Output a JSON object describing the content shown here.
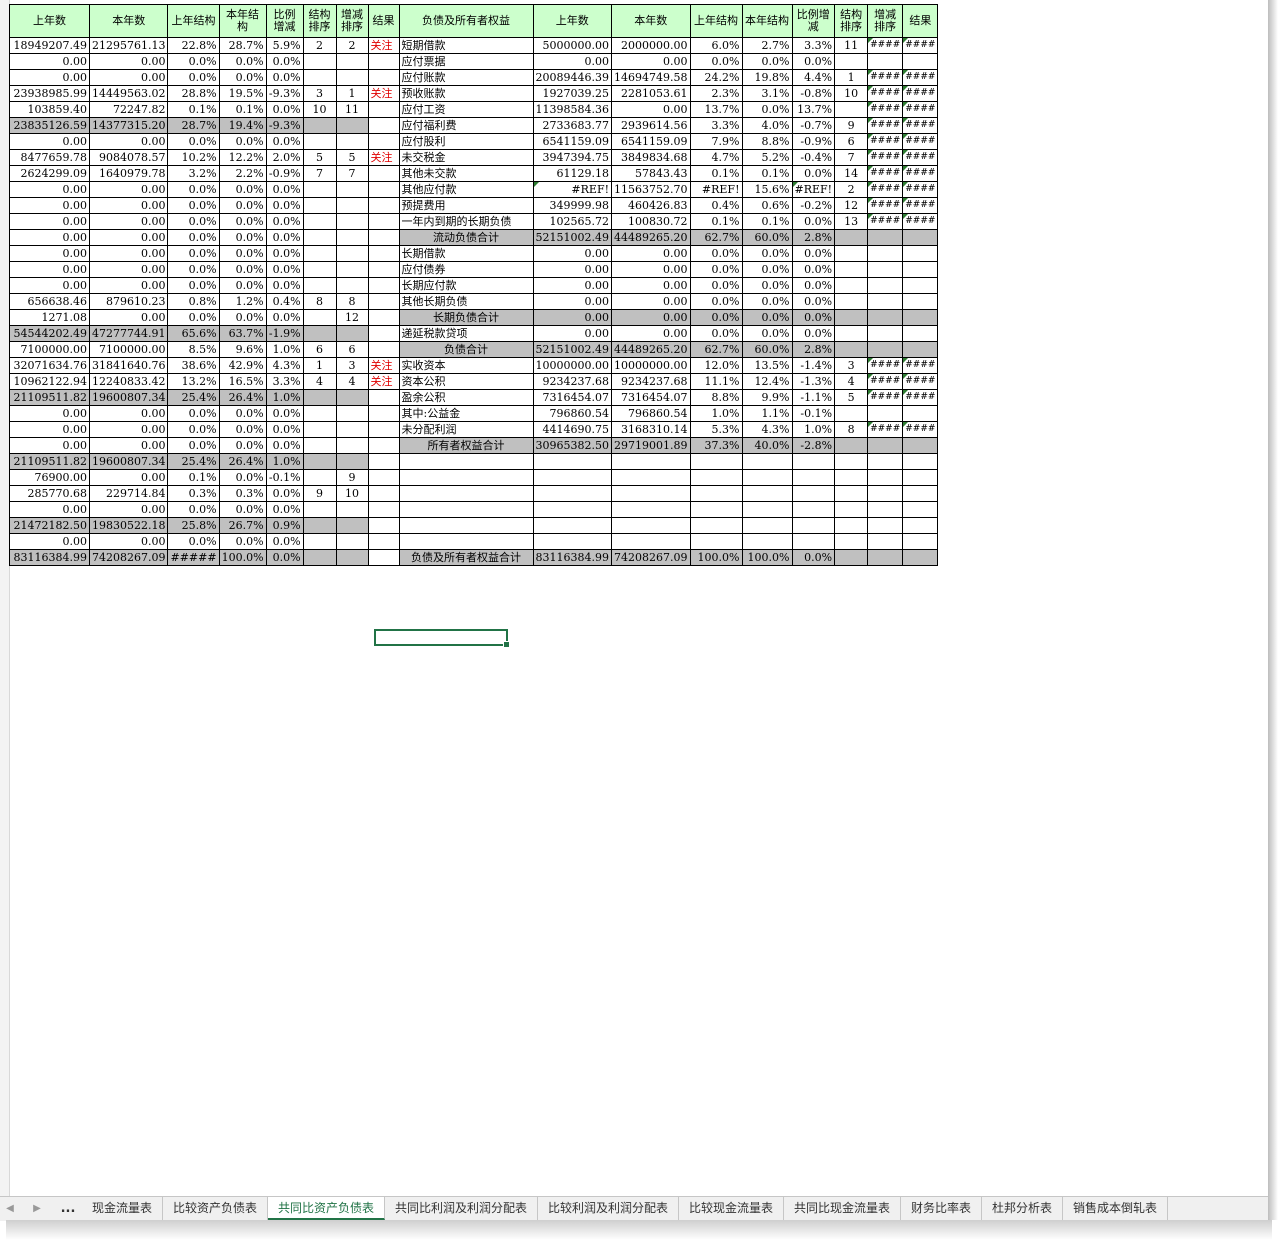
{
  "headers": {
    "left": [
      "上年数",
      "本年数",
      "上年结构",
      "本年结构",
      "比例增减",
      "结构排序",
      "增减排序",
      "结果"
    ],
    "right": [
      "负债及所有者权益",
      "上年数",
      "本年数",
      "上年结构",
      "本年结构",
      "比例增减",
      "结构排序",
      "增减排序",
      "结果"
    ]
  },
  "rows": [
    {
      "l": [
        "18949207.49",
        "21295761.13",
        "22.8%",
        "28.7%",
        "5.9%",
        "2",
        "2",
        "关注"
      ],
      "r": [
        "短期借款",
        "5000000.00",
        "2000000.00",
        "6.0%",
        "2.7%",
        "3.3%",
        "11",
        "####",
        "####"
      ]
    },
    {
      "l": [
        "0.00",
        "0.00",
        "0.0%",
        "0.0%",
        "0.0%",
        "",
        "",
        ""
      ],
      "r": [
        "应付票据",
        "0.00",
        "0.00",
        "0.0%",
        "0.0%",
        "0.0%",
        "",
        "",
        ""
      ]
    },
    {
      "l": [
        "0.00",
        "0.00",
        "0.0%",
        "0.0%",
        "0.0%",
        "",
        "",
        ""
      ],
      "r": [
        "应付账款",
        "20089446.39",
        "14694749.58",
        "24.2%",
        "19.8%",
        "4.4%",
        "1",
        "####",
        "####"
      ]
    },
    {
      "l": [
        "23938985.99",
        "14449563.02",
        "28.8%",
        "19.5%",
        "-9.3%",
        "3",
        "1",
        "关注"
      ],
      "r": [
        "预收账款",
        "1927039.25",
        "2281053.61",
        "2.3%",
        "3.1%",
        "-0.8%",
        "10",
        "####",
        "####"
      ]
    },
    {
      "l": [
        "103859.40",
        "72247.82",
        "0.1%",
        "0.1%",
        "0.0%",
        "10",
        "11",
        ""
      ],
      "r": [
        "应付工资",
        "11398584.36",
        "0.00",
        "13.7%",
        "0.0%",
        "13.7%",
        "",
        "####",
        "####"
      ]
    },
    {
      "l": [
        "23835126.59",
        "14377315.20",
        "28.7%",
        "19.4%",
        "-9.3%",
        "",
        "",
        ""
      ],
      "r": [
        "应付福利费",
        "2733683.77",
        "2939614.56",
        "3.3%",
        "4.0%",
        "-0.7%",
        "9",
        "####",
        "####"
      ],
      "ltot": true
    },
    {
      "l": [
        "0.00",
        "0.00",
        "0.0%",
        "0.0%",
        "0.0%",
        "",
        "",
        ""
      ],
      "r": [
        "应付股利",
        "6541159.09",
        "6541159.09",
        "7.9%",
        "8.8%",
        "-0.9%",
        "6",
        "####",
        "####"
      ]
    },
    {
      "l": [
        "8477659.78",
        "9084078.57",
        "10.2%",
        "12.2%",
        "2.0%",
        "5",
        "5",
        "关注"
      ],
      "r": [
        "未交税金",
        "3947394.75",
        "3849834.68",
        "4.7%",
        "5.2%",
        "-0.4%",
        "7",
        "####",
        "####"
      ]
    },
    {
      "l": [
        "2624299.09",
        "1640979.78",
        "3.2%",
        "2.2%",
        "-0.9%",
        "7",
        "7",
        ""
      ],
      "r": [
        "其他未交款",
        "61129.18",
        "57843.43",
        "0.1%",
        "0.1%",
        "0.0%",
        "14",
        "####",
        "####"
      ]
    },
    {
      "l": [
        "0.00",
        "0.00",
        "0.0%",
        "0.0%",
        "0.0%",
        "",
        "",
        ""
      ],
      "r": [
        "其他应付款",
        "#REF!",
        "11563752.70",
        "#REF!",
        "15.6%",
        "#REF!",
        "2",
        "####",
        "####"
      ]
    },
    {
      "l": [
        "0.00",
        "0.00",
        "0.0%",
        "0.0%",
        "0.0%",
        "",
        "",
        ""
      ],
      "r": [
        "预提费用",
        "349999.98",
        "460426.83",
        "0.4%",
        "0.6%",
        "-0.2%",
        "12",
        "####",
        "####"
      ]
    },
    {
      "l": [
        "0.00",
        "0.00",
        "0.0%",
        "0.0%",
        "0.0%",
        "",
        "",
        ""
      ],
      "r": [
        "一年内到期的长期负债",
        "102565.72",
        "100830.72",
        "0.1%",
        "0.1%",
        "0.0%",
        "13",
        "####",
        "####"
      ]
    },
    {
      "l": [
        "0.00",
        "0.00",
        "0.0%",
        "0.0%",
        "0.0%",
        "",
        "",
        ""
      ],
      "r": [
        "流动负债合计",
        "52151002.49",
        "44489265.20",
        "62.7%",
        "60.0%",
        "2.8%",
        "",
        "",
        ""
      ],
      "rtot": true
    },
    {
      "l": [
        "0.00",
        "0.00",
        "0.0%",
        "0.0%",
        "0.0%",
        "",
        "",
        ""
      ],
      "r": [
        "长期借款",
        "0.00",
        "0.00",
        "0.0%",
        "0.0%",
        "0.0%",
        "",
        "",
        ""
      ]
    },
    {
      "l": [
        "0.00",
        "0.00",
        "0.0%",
        "0.0%",
        "0.0%",
        "",
        "",
        ""
      ],
      "r": [
        "应付债券",
        "0.00",
        "0.00",
        "0.0%",
        "0.0%",
        "0.0%",
        "",
        "",
        ""
      ]
    },
    {
      "l": [
        "0.00",
        "0.00",
        "0.0%",
        "0.0%",
        "0.0%",
        "",
        "",
        ""
      ],
      "r": [
        "长期应付款",
        "0.00",
        "0.00",
        "0.0%",
        "0.0%",
        "0.0%",
        "",
        "",
        ""
      ]
    },
    {
      "l": [
        "656638.46",
        "879610.23",
        "0.8%",
        "1.2%",
        "0.4%",
        "8",
        "8",
        ""
      ],
      "r": [
        "其他长期负债",
        "0.00",
        "0.00",
        "0.0%",
        "0.0%",
        "0.0%",
        "",
        "",
        ""
      ]
    },
    {
      "l": [
        "1271.08",
        "0.00",
        "0.0%",
        "0.0%",
        "0.0%",
        "",
        "12",
        ""
      ],
      "r": [
        "长期负债合计",
        "0.00",
        "0.00",
        "0.0%",
        "0.0%",
        "0.0%",
        "",
        "",
        ""
      ],
      "rtot": true
    },
    {
      "l": [
        "54544202.49",
        "47277744.91",
        "65.6%",
        "63.7%",
        "-1.9%",
        "",
        "",
        ""
      ],
      "r": [
        "递延税款贷项",
        "0.00",
        "0.00",
        "0.0%",
        "0.0%",
        "0.0%",
        "",
        "",
        ""
      ],
      "ltot": true
    },
    {
      "l": [
        "7100000.00",
        "7100000.00",
        "8.5%",
        "9.6%",
        "1.0%",
        "6",
        "6",
        ""
      ],
      "r": [
        "负债合计",
        "52151002.49",
        "44489265.20",
        "62.7%",
        "60.0%",
        "2.8%",
        "",
        "",
        ""
      ],
      "rtot": true
    },
    {
      "l": [
        "32071634.76",
        "31841640.76",
        "38.6%",
        "42.9%",
        "4.3%",
        "1",
        "3",
        "关注"
      ],
      "r": [
        "实收资本",
        "10000000.00",
        "10000000.00",
        "12.0%",
        "13.5%",
        "-1.4%",
        "3",
        "####",
        "####"
      ]
    },
    {
      "l": [
        "10962122.94",
        "12240833.42",
        "13.2%",
        "16.5%",
        "3.3%",
        "4",
        "4",
        "关注"
      ],
      "r": [
        "资本公积",
        "9234237.68",
        "9234237.68",
        "11.1%",
        "12.4%",
        "-1.3%",
        "4",
        "####",
        "####"
      ]
    },
    {
      "l": [
        "21109511.82",
        "19600807.34",
        "25.4%",
        "26.4%",
        "1.0%",
        "",
        "",
        ""
      ],
      "r": [
        "盈余公积",
        "7316454.07",
        "7316454.07",
        "8.8%",
        "9.9%",
        "-1.1%",
        "5",
        "####",
        "####"
      ],
      "ltot": true
    },
    {
      "l": [
        "0.00",
        "0.00",
        "0.0%",
        "0.0%",
        "0.0%",
        "",
        "",
        ""
      ],
      "r": [
        "其中:公益金",
        "796860.54",
        "796860.54",
        "1.0%",
        "1.1%",
        "-0.1%",
        "",
        "",
        ""
      ]
    },
    {
      "l": [
        "0.00",
        "0.00",
        "0.0%",
        "0.0%",
        "0.0%",
        "",
        "",
        ""
      ],
      "r": [
        "未分配利润",
        "4414690.75",
        "3168310.14",
        "5.3%",
        "4.3%",
        "1.0%",
        "8",
        "####",
        "####"
      ]
    },
    {
      "l": [
        "0.00",
        "0.00",
        "0.0%",
        "0.0%",
        "0.0%",
        "",
        "",
        ""
      ],
      "r": [
        "所有者权益合计",
        "30965382.50",
        "29719001.89",
        "37.3%",
        "40.0%",
        "-2.8%",
        "",
        "",
        ""
      ],
      "rtot": true
    },
    {
      "l": [
        "21109511.82",
        "19600807.34",
        "25.4%",
        "26.4%",
        "1.0%",
        "",
        "",
        ""
      ],
      "r": [
        "",
        "",
        "",
        "",
        "",
        "",
        "",
        "",
        ""
      ],
      "ltot": true
    },
    {
      "l": [
        "76900.00",
        "0.00",
        "0.1%",
        "0.0%",
        "-0.1%",
        "",
        "9",
        ""
      ],
      "r": [
        "",
        "",
        "",
        "",
        "",
        "",
        "",
        "",
        ""
      ]
    },
    {
      "l": [
        "285770.68",
        "229714.84",
        "0.3%",
        "0.3%",
        "0.0%",
        "9",
        "10",
        ""
      ],
      "r": [
        "",
        "",
        "",
        "",
        "",
        "",
        "",
        "",
        ""
      ]
    },
    {
      "l": [
        "0.00",
        "0.00",
        "0.0%",
        "0.0%",
        "0.0%",
        "",
        "",
        ""
      ],
      "r": [
        "",
        "",
        "",
        "",
        "",
        "",
        "",
        "",
        ""
      ]
    },
    {
      "l": [
        "21472182.50",
        "19830522.18",
        "25.8%",
        "26.7%",
        "0.9%",
        "",
        "",
        ""
      ],
      "r": [
        "",
        "",
        "",
        "",
        "",
        "",
        "",
        "",
        ""
      ],
      "ltot": true
    },
    {
      "l": [
        "0.00",
        "0.00",
        "0.0%",
        "0.0%",
        "0.0%",
        "",
        "",
        ""
      ],
      "r": [
        "",
        "",
        "",
        "",
        "",
        "",
        "",
        "",
        ""
      ]
    },
    {
      "l": [
        "83116384.99",
        "74208267.09",
        "#####",
        "100.0%",
        "0.0%",
        "",
        "",
        ""
      ],
      "r": [
        "负债及所有者权益合计",
        "83116384.99",
        "74208267.09",
        "100.0%",
        "100.0%",
        "0.0%",
        "",
        "",
        ""
      ],
      "ltot": true,
      "rtot": true
    }
  ],
  "tabs": [
    "现金流量表",
    "比较资产负债表",
    "共同比资产负债表",
    "共同比利润及利润分配表",
    "比较利润及利润分配表",
    "比较现金流量表",
    "共同比现金流量表",
    "财务比率表",
    "杜邦分析表",
    "销售成本倒轧表"
  ],
  "active_tab": "共同比资产负债表",
  "tab_overflow": "...",
  "colors": {
    "header_bg": "#ccffcc",
    "total_bg": "#c0c0c0",
    "mark_red": "#e00000",
    "accent": "#217346"
  }
}
